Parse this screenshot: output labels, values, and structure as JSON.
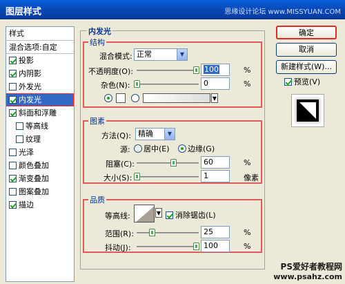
{
  "window": {
    "title": "图层样式",
    "watermark": "思缘设计论坛 www.MISSYUAN.COM"
  },
  "style_list": {
    "header": "样式",
    "blend_options": "混合选项:自定",
    "items": [
      {
        "label": "投影",
        "checked": true
      },
      {
        "label": "内阴影",
        "checked": true
      },
      {
        "label": "外发光",
        "checked": false
      },
      {
        "label": "内发光",
        "checked": true,
        "selected": true
      },
      {
        "label": "斜面和浮雕",
        "checked": true
      },
      {
        "label": "等高线",
        "checked": false,
        "sub": true
      },
      {
        "label": "纹理",
        "checked": false,
        "sub": true
      },
      {
        "label": "光泽",
        "checked": false
      },
      {
        "label": "颜色叠加",
        "checked": false
      },
      {
        "label": "渐变叠加",
        "checked": true
      },
      {
        "label": "图案叠加",
        "checked": false
      },
      {
        "label": "描边",
        "checked": true
      }
    ]
  },
  "buttons": {
    "ok": "确定",
    "cancel": "取消",
    "new_style": "新建样式(W)...",
    "preview": "预览(V)"
  },
  "inner_glow": {
    "title": "内发光",
    "structure": {
      "title": "结构",
      "blend_mode_label": "混合模式:",
      "blend_mode_value": "正常",
      "opacity_label": "不透明度(O):",
      "opacity_value": "100",
      "opacity_unit": "%",
      "noise_label": "杂色(N):",
      "noise_value": "0",
      "noise_unit": "%"
    },
    "elements": {
      "title": "图素",
      "technique_label": "方法(Q):",
      "technique_value": "精确",
      "source_label": "源:",
      "source_center": "居中(E)",
      "source_edge": "边缘(G)",
      "choke_label": "阻塞(C):",
      "choke_value": "60",
      "choke_unit": "%",
      "size_label": "大小(S):",
      "size_value": "1",
      "size_unit": "像素"
    },
    "quality": {
      "title": "品质",
      "contour_label": "等高线:",
      "antialias_label": "消除锯齿(L)",
      "range_label": "范围(R):",
      "range_value": "25",
      "range_unit": "%",
      "jitter_label": "抖动(J):",
      "jitter_value": "100",
      "jitter_unit": "%"
    }
  },
  "footer": {
    "site": "PS爱好者教程网",
    "url": "www.psahz.com"
  }
}
